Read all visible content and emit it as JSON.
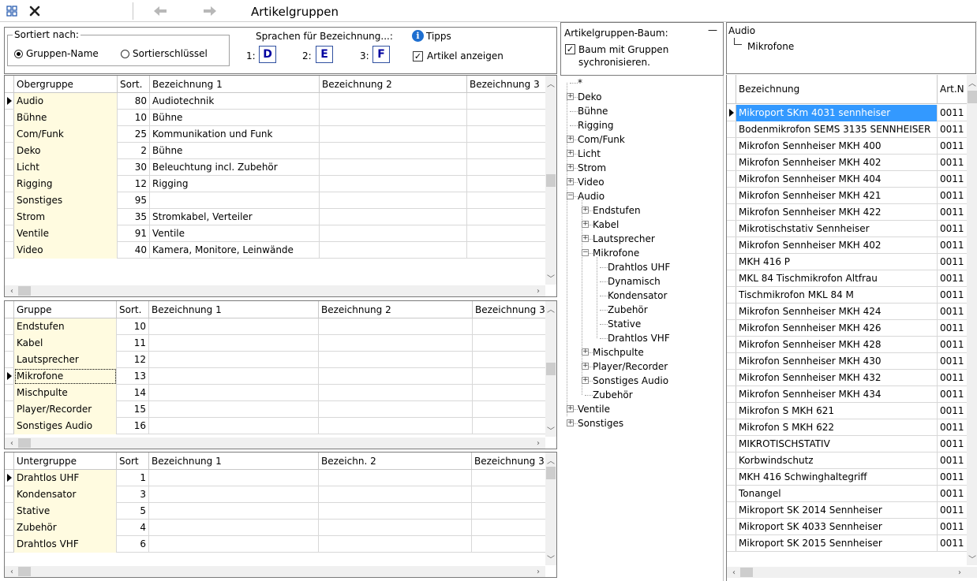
{
  "window": {
    "title": "Artikelgruppen"
  },
  "toolbar": {
    "grid_icon": "grid-icon",
    "close_icon": "close-icon",
    "back_icon": "arrow-left-icon",
    "forward_icon": "arrow-right-icon"
  },
  "options": {
    "sort_label": "Sortiert nach:",
    "sort_opt1": "Gruppen-Name",
    "sort_opt2": "Sortierschlüssel",
    "sort_selected": "Gruppen-Name",
    "lang_label": "Sprachen für Bezeichnung...:",
    "lang1_label": "1:",
    "lang1": "D",
    "lang2_label": "2:",
    "lang2": "E",
    "lang3_label": "3:",
    "lang3": "F",
    "tips_label": "Tipps",
    "show_articles_label": "Artikel anzeigen",
    "show_articles": true
  },
  "grid1": {
    "headers": [
      "Obergruppe",
      "Sort.",
      "Bezeichnung 1",
      "Bezeichnung 2",
      "Bezeichnung 3"
    ],
    "current_row": 0,
    "rows": [
      [
        "Audio",
        "80",
        "Audiotechnik",
        "",
        ""
      ],
      [
        "Bühne",
        "10",
        "Bühne",
        "",
        ""
      ],
      [
        "Com/Funk",
        "25",
        "Kommunikation und Funk",
        "",
        ""
      ],
      [
        "Deko",
        "2",
        "Bühne",
        "",
        ""
      ],
      [
        "Licht",
        "30",
        "Beleuchtung incl. Zubehör",
        "",
        ""
      ],
      [
        "Rigging",
        "12",
        "Rigging",
        "",
        ""
      ],
      [
        "Sonstiges",
        "95",
        "",
        "",
        ""
      ],
      [
        "Strom",
        "35",
        "Stromkabel, Verteiler",
        "",
        ""
      ],
      [
        "Ventile",
        "91",
        "Ventile",
        "",
        ""
      ],
      [
        "Video",
        "40",
        "Kamera, Monitore, Leinwände",
        "",
        ""
      ]
    ]
  },
  "grid2": {
    "headers": [
      "Gruppe",
      "Sort.",
      "Bezeichnung 1",
      "Bezeichnung 2",
      "Bezeichnung 3"
    ],
    "current_row": 3,
    "rows": [
      [
        "Endstufen",
        "10",
        "",
        "",
        ""
      ],
      [
        "Kabel",
        "11",
        "",
        "",
        ""
      ],
      [
        "Lautsprecher",
        "12",
        "",
        "",
        ""
      ],
      [
        "Mikrofone",
        "13",
        "",
        "",
        ""
      ],
      [
        "Mischpulte",
        "14",
        "",
        "",
        ""
      ],
      [
        "Player/Recorder",
        "15",
        "",
        "",
        ""
      ],
      [
        "Sonstiges Audio",
        "16",
        "",
        "",
        ""
      ]
    ]
  },
  "grid3": {
    "headers": [
      "Untergruppe",
      "Sort",
      "Bezeichnung 1",
      "Bezeichn. 2",
      "Bezeichnung 3"
    ],
    "current_row": 0,
    "rows": [
      [
        "Drahtlos UHF",
        "1",
        "",
        "",
        ""
      ],
      [
        "Kondensator",
        "3",
        "",
        "",
        ""
      ],
      [
        "Stative",
        "5",
        "",
        "",
        ""
      ],
      [
        "Zubehör",
        "4",
        "",
        "",
        ""
      ],
      [
        "Drahtlos VHF",
        "6",
        "",
        "",
        ""
      ]
    ]
  },
  "tree": {
    "title": "Artikelgruppen-Baum:",
    "collapse_symbol": "—",
    "sync_label": "Baum mit Gruppen sychronisieren.",
    "sync_checked": true,
    "nodes": [
      {
        "label": "*",
        "level": 0,
        "expander": "none"
      },
      {
        "label": "Deko",
        "level": 0,
        "expander": "plus"
      },
      {
        "label": "Bühne",
        "level": 0,
        "expander": "none"
      },
      {
        "label": "Rigging",
        "level": 0,
        "expander": "none"
      },
      {
        "label": "Com/Funk",
        "level": 0,
        "expander": "plus"
      },
      {
        "label": "Licht",
        "level": 0,
        "expander": "plus"
      },
      {
        "label": "Strom",
        "level": 0,
        "expander": "plus"
      },
      {
        "label": "Video",
        "level": 0,
        "expander": "plus"
      },
      {
        "label": "Audio",
        "level": 0,
        "expander": "minus"
      },
      {
        "label": "Endstufen",
        "level": 1,
        "expander": "plus"
      },
      {
        "label": "Kabel",
        "level": 1,
        "expander": "plus"
      },
      {
        "label": "Lautsprecher",
        "level": 1,
        "expander": "plus"
      },
      {
        "label": "Mikrofone",
        "level": 1,
        "expander": "minus"
      },
      {
        "label": "Drahtlos UHF",
        "level": 2,
        "expander": "none"
      },
      {
        "label": "Dynamisch",
        "level": 2,
        "expander": "none"
      },
      {
        "label": "Kondensator",
        "level": 2,
        "expander": "none"
      },
      {
        "label": "Zubehör",
        "level": 2,
        "expander": "none"
      },
      {
        "label": "Stative",
        "level": 2,
        "expander": "none"
      },
      {
        "label": "Drahtlos VHF",
        "level": 2,
        "expander": "none"
      },
      {
        "label": "Mischpulte",
        "level": 1,
        "expander": "plus"
      },
      {
        "label": "Player/Recorder",
        "level": 1,
        "expander": "plus"
      },
      {
        "label": "Sonstiges Audio",
        "level": 1,
        "expander": "plus"
      },
      {
        "label": "Zubehör",
        "level": 1,
        "expander": "none"
      },
      {
        "label": "Ventile",
        "level": 0,
        "expander": "plus"
      },
      {
        "label": "Sonstiges",
        "level": 0,
        "expander": "plus"
      }
    ]
  },
  "articles": {
    "breadcrumb_parent": "Audio",
    "breadcrumb_child": "Mikrofone",
    "headers": [
      "Bezeichnung",
      "Art.N"
    ],
    "selected_row": 0,
    "rows": [
      [
        "Mikroport SKm 4031 sennheiser",
        "0011"
      ],
      [
        "Bodenmikrofon SEMS 3135 SENNHEISER",
        "0011"
      ],
      [
        "Mikrofon Sennheiser MKH 400",
        "0011"
      ],
      [
        "Mikrofon Sennheiser MKH 402",
        "0011"
      ],
      [
        "Mikrofon Sennheiser MKH 404",
        "0011"
      ],
      [
        "Mikrofon Sennheiser MKH 421",
        "0011"
      ],
      [
        "Mikrofon Sennheiser MKH 422",
        "0011"
      ],
      [
        "Mikrotischstativ Sennheiser",
        "0011"
      ],
      [
        "Mikrofon Sennheiser MKH 402",
        "0011"
      ],
      [
        "MKH 416 P",
        "0011"
      ],
      [
        "MKL 84 Tischmikrofon Altfrau",
        "0011"
      ],
      [
        "Tischmikrofon MKL 84 M",
        "0011"
      ],
      [
        "Mikrofon Sennheiser MKH 424",
        "0011"
      ],
      [
        "Mikrofon Sennheiser MKH 426",
        "0011"
      ],
      [
        "Mikrofon Sennheiser MKH 428",
        "0011"
      ],
      [
        "Mikrofon Sennheiser MKH 430",
        "0011"
      ],
      [
        "Mikrofon Sennheiser MKH 432",
        "0011"
      ],
      [
        "Mikrofon Sennheiser MKH 434",
        "0011"
      ],
      [
        "Mikrofon S MKH 621",
        "0011"
      ],
      [
        "Mikrofon S MKH 622",
        "0011"
      ],
      [
        "MIKROTISCHSTATIV",
        "0011"
      ],
      [
        "Korbwindschutz",
        "0011"
      ],
      [
        "MKH 416 Schwinghaltegriff",
        "0011"
      ],
      [
        "Tonangel",
        "0011"
      ],
      [
        "Mikroport SK 2014 Sennheiser",
        "0011"
      ],
      [
        "Mikroport SK 4033 Sennheiser",
        "0011"
      ],
      [
        "Mikroport SK 2015 Sennheiser",
        "0011"
      ]
    ]
  },
  "colors": {
    "selection": "#3399ff",
    "key_column": "#fffbe0",
    "lang_text": "#0000a0",
    "info_icon": "#1e6fd0"
  }
}
